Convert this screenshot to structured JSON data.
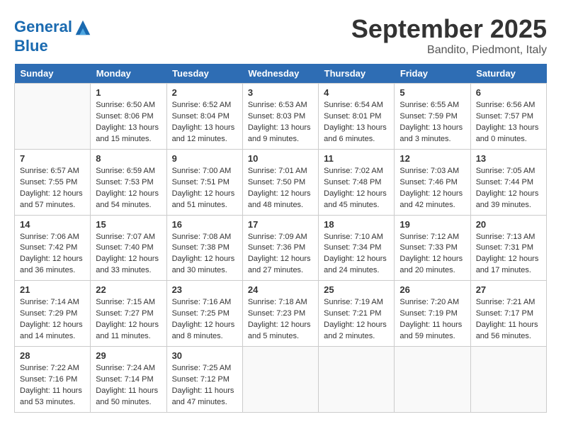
{
  "header": {
    "logo_line1": "General",
    "logo_line2": "Blue",
    "month": "September 2025",
    "location": "Bandito, Piedmont, Italy"
  },
  "days_of_week": [
    "Sunday",
    "Monday",
    "Tuesday",
    "Wednesday",
    "Thursday",
    "Friday",
    "Saturday"
  ],
  "weeks": [
    [
      {
        "day": "",
        "content": ""
      },
      {
        "day": "1",
        "content": "Sunrise: 6:50 AM\nSunset: 8:06 PM\nDaylight: 13 hours\nand 15 minutes."
      },
      {
        "day": "2",
        "content": "Sunrise: 6:52 AM\nSunset: 8:04 PM\nDaylight: 13 hours\nand 12 minutes."
      },
      {
        "day": "3",
        "content": "Sunrise: 6:53 AM\nSunset: 8:03 PM\nDaylight: 13 hours\nand 9 minutes."
      },
      {
        "day": "4",
        "content": "Sunrise: 6:54 AM\nSunset: 8:01 PM\nDaylight: 13 hours\nand 6 minutes."
      },
      {
        "day": "5",
        "content": "Sunrise: 6:55 AM\nSunset: 7:59 PM\nDaylight: 13 hours\nand 3 minutes."
      },
      {
        "day": "6",
        "content": "Sunrise: 6:56 AM\nSunset: 7:57 PM\nDaylight: 13 hours\nand 0 minutes."
      }
    ],
    [
      {
        "day": "7",
        "content": "Sunrise: 6:57 AM\nSunset: 7:55 PM\nDaylight: 12 hours\nand 57 minutes."
      },
      {
        "day": "8",
        "content": "Sunrise: 6:59 AM\nSunset: 7:53 PM\nDaylight: 12 hours\nand 54 minutes."
      },
      {
        "day": "9",
        "content": "Sunrise: 7:00 AM\nSunset: 7:51 PM\nDaylight: 12 hours\nand 51 minutes."
      },
      {
        "day": "10",
        "content": "Sunrise: 7:01 AM\nSunset: 7:50 PM\nDaylight: 12 hours\nand 48 minutes."
      },
      {
        "day": "11",
        "content": "Sunrise: 7:02 AM\nSunset: 7:48 PM\nDaylight: 12 hours\nand 45 minutes."
      },
      {
        "day": "12",
        "content": "Sunrise: 7:03 AM\nSunset: 7:46 PM\nDaylight: 12 hours\nand 42 minutes."
      },
      {
        "day": "13",
        "content": "Sunrise: 7:05 AM\nSunset: 7:44 PM\nDaylight: 12 hours\nand 39 minutes."
      }
    ],
    [
      {
        "day": "14",
        "content": "Sunrise: 7:06 AM\nSunset: 7:42 PM\nDaylight: 12 hours\nand 36 minutes."
      },
      {
        "day": "15",
        "content": "Sunrise: 7:07 AM\nSunset: 7:40 PM\nDaylight: 12 hours\nand 33 minutes."
      },
      {
        "day": "16",
        "content": "Sunrise: 7:08 AM\nSunset: 7:38 PM\nDaylight: 12 hours\nand 30 minutes."
      },
      {
        "day": "17",
        "content": "Sunrise: 7:09 AM\nSunset: 7:36 PM\nDaylight: 12 hours\nand 27 minutes."
      },
      {
        "day": "18",
        "content": "Sunrise: 7:10 AM\nSunset: 7:34 PM\nDaylight: 12 hours\nand 24 minutes."
      },
      {
        "day": "19",
        "content": "Sunrise: 7:12 AM\nSunset: 7:33 PM\nDaylight: 12 hours\nand 20 minutes."
      },
      {
        "day": "20",
        "content": "Sunrise: 7:13 AM\nSunset: 7:31 PM\nDaylight: 12 hours\nand 17 minutes."
      }
    ],
    [
      {
        "day": "21",
        "content": "Sunrise: 7:14 AM\nSunset: 7:29 PM\nDaylight: 12 hours\nand 14 minutes."
      },
      {
        "day": "22",
        "content": "Sunrise: 7:15 AM\nSunset: 7:27 PM\nDaylight: 12 hours\nand 11 minutes."
      },
      {
        "day": "23",
        "content": "Sunrise: 7:16 AM\nSunset: 7:25 PM\nDaylight: 12 hours\nand 8 minutes."
      },
      {
        "day": "24",
        "content": "Sunrise: 7:18 AM\nSunset: 7:23 PM\nDaylight: 12 hours\nand 5 minutes."
      },
      {
        "day": "25",
        "content": "Sunrise: 7:19 AM\nSunset: 7:21 PM\nDaylight: 12 hours\nand 2 minutes."
      },
      {
        "day": "26",
        "content": "Sunrise: 7:20 AM\nSunset: 7:19 PM\nDaylight: 11 hours\nand 59 minutes."
      },
      {
        "day": "27",
        "content": "Sunrise: 7:21 AM\nSunset: 7:17 PM\nDaylight: 11 hours\nand 56 minutes."
      }
    ],
    [
      {
        "day": "28",
        "content": "Sunrise: 7:22 AM\nSunset: 7:16 PM\nDaylight: 11 hours\nand 53 minutes."
      },
      {
        "day": "29",
        "content": "Sunrise: 7:24 AM\nSunset: 7:14 PM\nDaylight: 11 hours\nand 50 minutes."
      },
      {
        "day": "30",
        "content": "Sunrise: 7:25 AM\nSunset: 7:12 PM\nDaylight: 11 hours\nand 47 minutes."
      },
      {
        "day": "",
        "content": ""
      },
      {
        "day": "",
        "content": ""
      },
      {
        "day": "",
        "content": ""
      },
      {
        "day": "",
        "content": ""
      }
    ]
  ]
}
